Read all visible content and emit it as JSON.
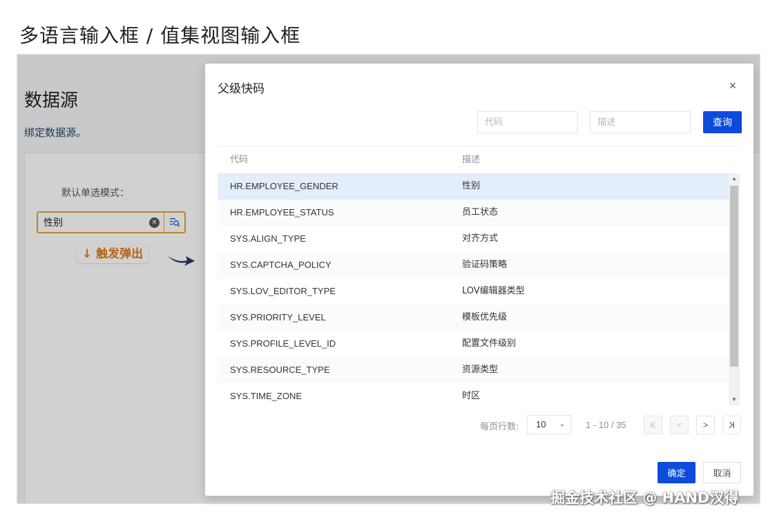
{
  "heading": "多语言输入框 / 值集视图输入框",
  "background": {
    "title": "数据源",
    "subtitle": "绑定数据源。",
    "field_label": "默认单选模式：",
    "field_value": "性别",
    "callout": "↓ 触发弹出"
  },
  "modal": {
    "title": "父级快码",
    "close_symbol": "×",
    "search": {
      "code_placeholder": "代码",
      "desc_placeholder": "描述",
      "query_label": "查询"
    },
    "columns": {
      "code": "代码",
      "desc": "描述"
    },
    "rows": [
      {
        "code": "HR.EMPLOYEE_GENDER",
        "desc": "性别"
      },
      {
        "code": "HR.EMPLOYEE_STATUS",
        "desc": "员工状态"
      },
      {
        "code": "SYS.ALIGN_TYPE",
        "desc": "对齐方式"
      },
      {
        "code": "SYS.CAPTCHA_POLICY",
        "desc": "验证码策略"
      },
      {
        "code": "SYS.LOV_EDITOR_TYPE",
        "desc": "LOV编辑器类型"
      },
      {
        "code": "SYS.PRIORITY_LEVEL",
        "desc": "模板优先级"
      },
      {
        "code": "SYS.PROFILE_LEVEL_ID",
        "desc": "配置文件级别"
      },
      {
        "code": "SYS.RESOURCE_TYPE",
        "desc": "资源类型"
      },
      {
        "code": "SYS.TIME_ZONE",
        "desc": "时区"
      }
    ],
    "pagination": {
      "page_size_label": "每页行数:",
      "page_size": "10",
      "range": "1 - 10 / 35",
      "first": "K",
      "prev": "<",
      "next": ">",
      "last": "K"
    },
    "ok_label": "确定",
    "cancel_label": "取消"
  },
  "watermark": "掘金技术社区 @ HAND汉得",
  "colors": {
    "primary": "#0c4bdc",
    "focus_border": "#e8a12a",
    "callout_text": "#e07b1a",
    "selected_row": "#e4edfb"
  }
}
